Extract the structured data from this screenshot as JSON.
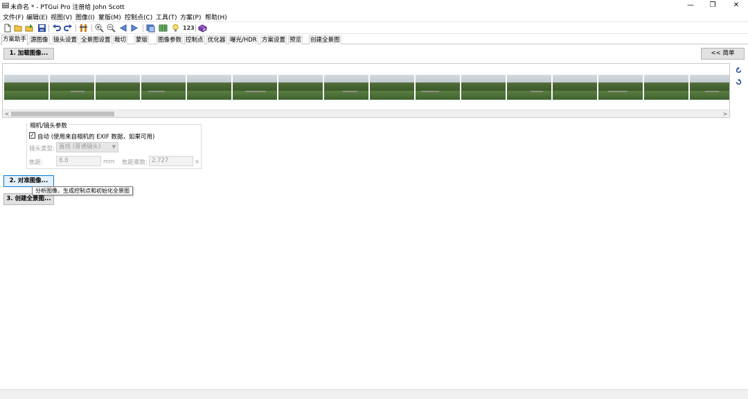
{
  "window": {
    "title": "未命名 * - PTGui Pro 注册给 John Scott",
    "minimize": "—",
    "restore": "❐",
    "close": "✕"
  },
  "menu": [
    "文件(F)",
    "编辑(E)",
    "视图(V)",
    "图像(I)",
    "蒙版(M)",
    "控制点(C)",
    "工具(T)",
    "方案(P)",
    "帮助(H)"
  ],
  "toolbar": {
    "numbering_label": "123"
  },
  "tabs": [
    "方案助手",
    "源图像",
    "镜头设置",
    "全景图设置",
    "裁切",
    "蒙版",
    "图像参数",
    "控制点",
    "优化器",
    "曝光/HDR",
    "方案设置",
    "预览",
    "创建全景图"
  ],
  "actions": {
    "load_images": "1. 加载图像...",
    "simple": "<< 简单",
    "align_images": "2. 对准图像...",
    "create_panorama": "3. 创建全景图..."
  },
  "scroll": {
    "left": "<",
    "right": ">"
  },
  "camera": {
    "group_title": "相机/镜头参数",
    "auto_checked": true,
    "auto_check_glyph": "✓",
    "auto_label": "自动 (使用来自相机的 EXIF 数据，如果可用)",
    "lens_type_label": "镜头类型:",
    "lens_type_value": "直线 (普通镜头)",
    "focal_length_label": "焦距:",
    "focal_length_value": "8.8",
    "focal_length_unit": "mm",
    "focal_multiplier_label": "焦距乘数:",
    "focal_multiplier_value": "2.727",
    "multiplier_unit": "x"
  },
  "tooltip": {
    "text": "分析图像，生成控制点和初始化全景图"
  },
  "colors": {
    "focus_border": "#0078d7",
    "button_bg": "#e1e1e1"
  }
}
